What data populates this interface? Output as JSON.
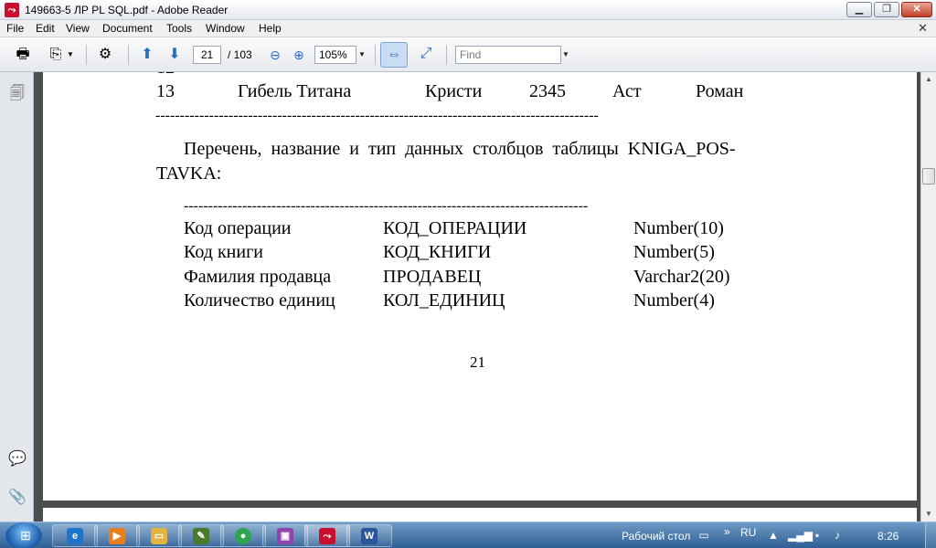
{
  "window": {
    "title": "149663-5 ЛР PL SQL.pdf - Adobe Reader"
  },
  "menu": {
    "items": [
      "File",
      "Edit",
      "View",
      "Document",
      "Tools",
      "Window",
      "Help"
    ]
  },
  "toolbar": {
    "page_current": "21",
    "page_total": "/ 103",
    "zoom": "105%",
    "find_placeholder": "Find"
  },
  "document": {
    "row13": {
      "num": "13",
      "title": "Гибель Титана",
      "author": "Кристи",
      "qty": "2345",
      "publisher": "Аст",
      "genre": "Роман"
    },
    "dash_line_1": "-------------------------------------------------------------------------------------------",
    "paragraph_line1": "Перечень,  название  и  тип  данных  столбцов  таблицы  KNIGA_POS-",
    "paragraph_line2": "TAVKA:",
    "dash_line_2": "-----------------------------------------------------------------------------------",
    "columns": [
      {
        "name": "Код операции",
        "code": "КОД_ОПЕРАЦИИ",
        "type": "Number(10)"
      },
      {
        "name": "Код книги",
        "code": "КОД_КНИГИ",
        "type": "Number(5)"
      },
      {
        "name": "Фамилия продавца",
        "code": "ПРОДАВЕЦ",
        "type": "Varchar2(20)"
      },
      {
        "name": "Количество единиц",
        "code": "КОЛ_ЕДИНИЦ",
        "type": "Number(4)"
      }
    ],
    "page_number": "21"
  },
  "taskbar": {
    "desktop_label": "Рабочий стол",
    "lang": "RU",
    "time": "8:26"
  }
}
